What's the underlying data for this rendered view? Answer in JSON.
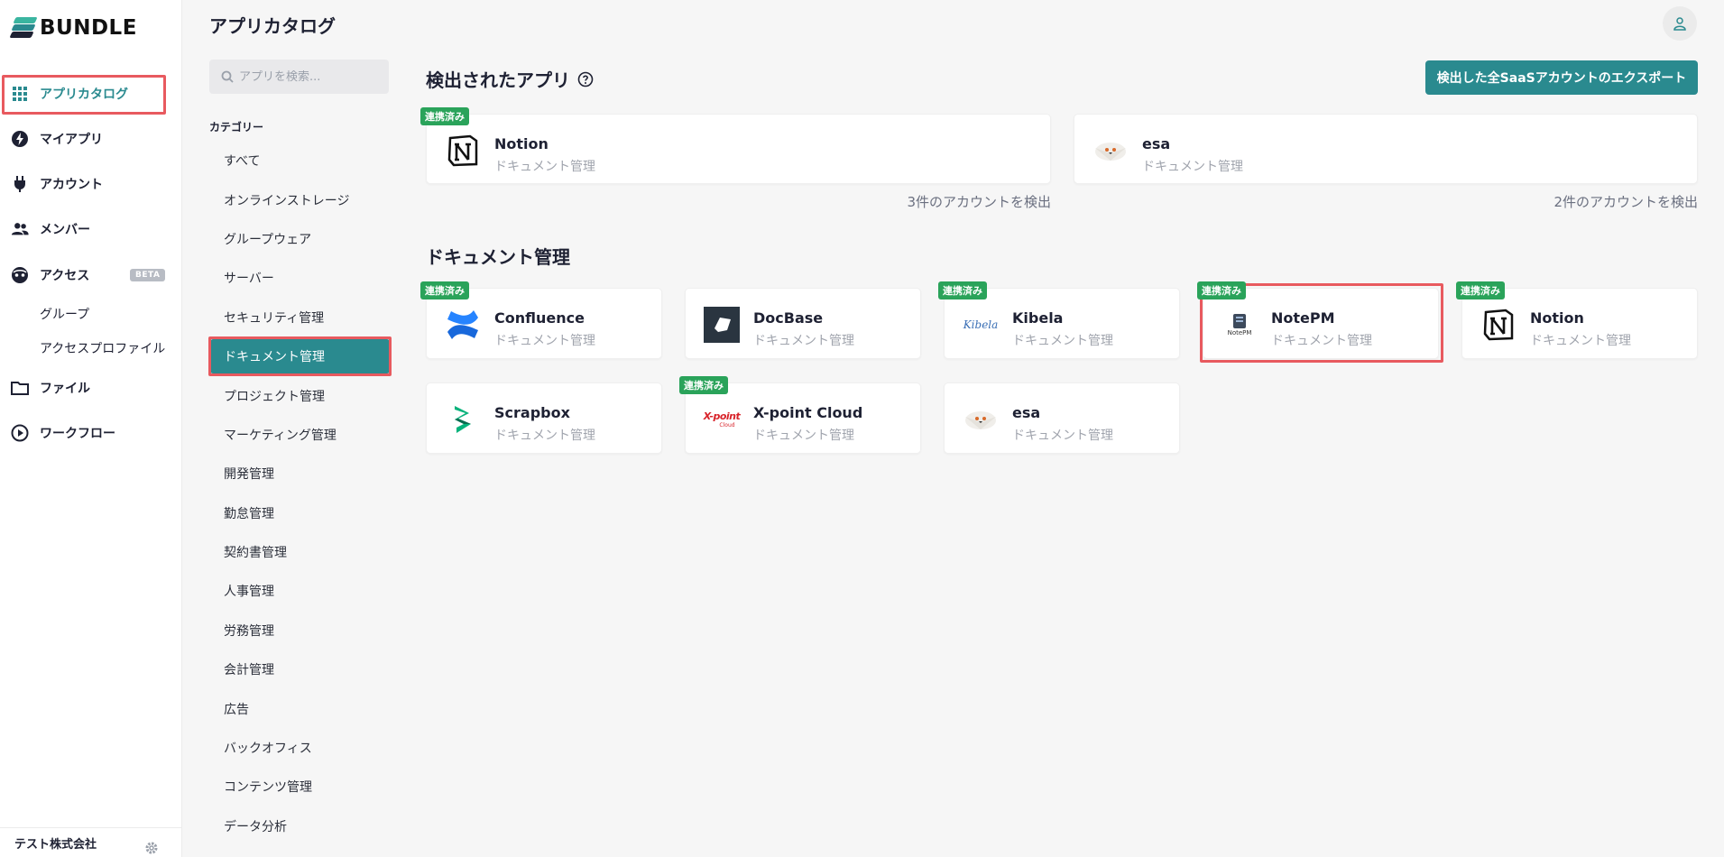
{
  "brand": {
    "name": "BUNDLE",
    "logo_colors": [
      "#2a8a8f",
      "#3ab5a0",
      "#1e2133"
    ]
  },
  "nav": {
    "items": [
      {
        "label": "アプリカタログ",
        "icon": "grid-icon",
        "active": true
      },
      {
        "label": "マイアプリ",
        "icon": "bolt-icon"
      },
      {
        "label": "アカウント",
        "icon": "plug-icon"
      },
      {
        "label": "メンバー",
        "icon": "people-icon"
      },
      {
        "label": "アクセス",
        "icon": "face-icon",
        "badge": "BETA"
      },
      {
        "label": "ファイル",
        "icon": "folder-icon"
      },
      {
        "label": "ワークフロー",
        "icon": "play-circle-icon"
      }
    ],
    "sub_items": [
      "グループ",
      "アクセスプロファイル"
    ],
    "company": "テスト株式会社"
  },
  "page": {
    "title": "アプリカタログ"
  },
  "search": {
    "placeholder": "アプリを検索..."
  },
  "categories": {
    "header": "カテゴリー",
    "items": [
      "すべて",
      "オンラインストレージ",
      "グループウェア",
      "サーバー",
      "セキュリティ管理",
      "ドキュメント管理",
      "プロジェクト管理",
      "マーケティング管理",
      "開発管理",
      "勤怠管理",
      "契約書管理",
      "人事管理",
      "労務管理",
      "会計管理",
      "広告",
      "バックオフィス",
      "コンテンツ管理",
      "データ分析"
    ],
    "selected": "ドキュメント管理"
  },
  "detected": {
    "title": "検出されたアプリ",
    "export_label": "検出した全SaaSアカウントのエクスポート",
    "apps": [
      {
        "name": "Notion",
        "category": "ドキュメント管理",
        "badge": "連携済み",
        "count_text": "3件のアカウントを検出"
      },
      {
        "name": "esa",
        "category": "ドキュメント管理",
        "count_text": "2件のアカウントを検出"
      }
    ]
  },
  "doc_section": {
    "title": "ドキュメント管理",
    "apps": [
      {
        "name": "Confluence",
        "category": "ドキュメント管理",
        "badge": "連携済み"
      },
      {
        "name": "DocBase",
        "category": "ドキュメント管理"
      },
      {
        "name": "Kibela",
        "category": "ドキュメント管理",
        "badge": "連携済み",
        "logo_text": "Kibela"
      },
      {
        "name": "NotePM",
        "category": "ドキュメント管理",
        "badge": "連携済み",
        "logo_text": "NotePM"
      },
      {
        "name": "Notion",
        "category": "ドキュメント管理",
        "badge": "連携済み"
      },
      {
        "name": "Scrapbox",
        "category": "ドキュメント管理"
      },
      {
        "name": "X-point Cloud",
        "category": "ドキュメント管理",
        "badge": "連携済み",
        "logo_text": "X-point",
        "logo_subtext": "Cloud"
      },
      {
        "name": "esa",
        "category": "ドキュメント管理"
      }
    ]
  },
  "colors": {
    "accent": "#2a8a8f",
    "badge": "#2aa35a",
    "highlight": "#e85a5f"
  }
}
